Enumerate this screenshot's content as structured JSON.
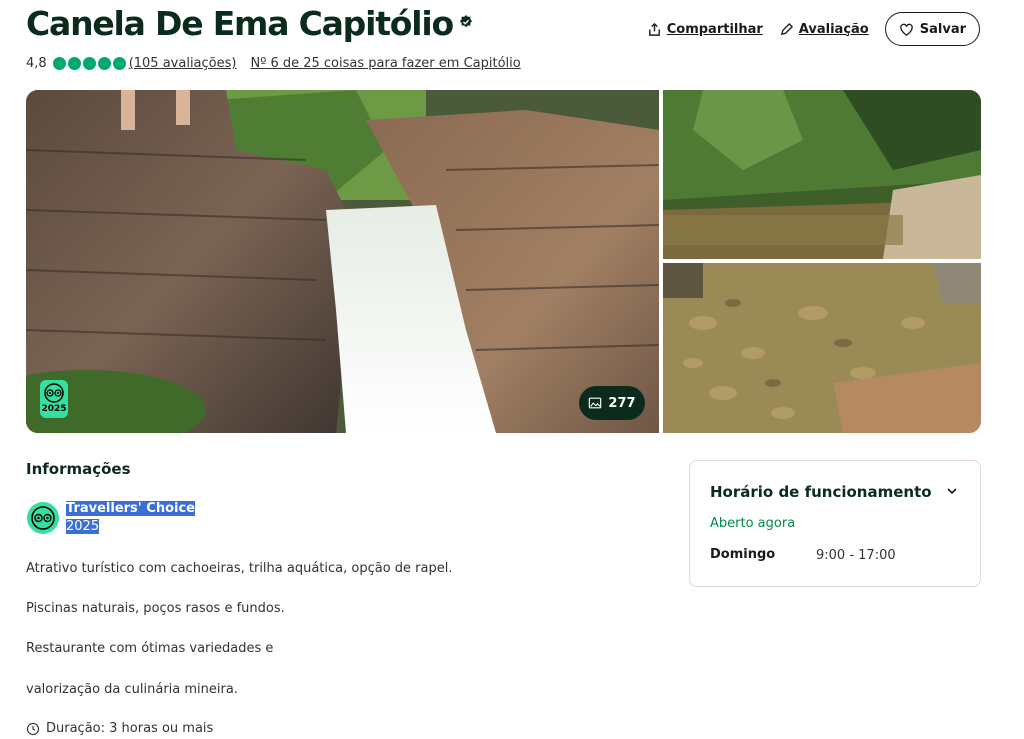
{
  "header": {
    "title": "Canela De Ema Capitólio",
    "verified_icon": "verified-badge-icon",
    "share_label": "Compartilhar",
    "review_label": "Avaliação",
    "save_label": "Salvar"
  },
  "rating": {
    "score": "4,8",
    "bubbles": 5,
    "reviews_text": "(105 avaliações)",
    "rank_text": "Nº 6 de 25 coisas para fazer em Capitólio"
  },
  "gallery": {
    "photo_count": "277",
    "award_year": "2025"
  },
  "info": {
    "section_title": "Informações",
    "award_name": "Travellers' Choice",
    "award_year": "2025",
    "paragraphs": [
      "Atrativo turístico com cachoeiras,  trilha aquática, opção de rapel.",
      "Piscinas naturais, poços rasos e fundos.",
      "Restaurante com ótimas variedades e",
      "valorização da culinária mineira."
    ],
    "duration": "Duração: 3 horas ou mais"
  },
  "hours": {
    "title": "Horário de funcionamento",
    "status": "Aberto agora",
    "day": "Domingo",
    "time": "9:00 - 17:00"
  },
  "colors": {
    "brand_dark": "#0b2b1d",
    "brand_green": "#00aa6c",
    "open_green": "#008a4c",
    "award_green": "#34e0a1"
  }
}
